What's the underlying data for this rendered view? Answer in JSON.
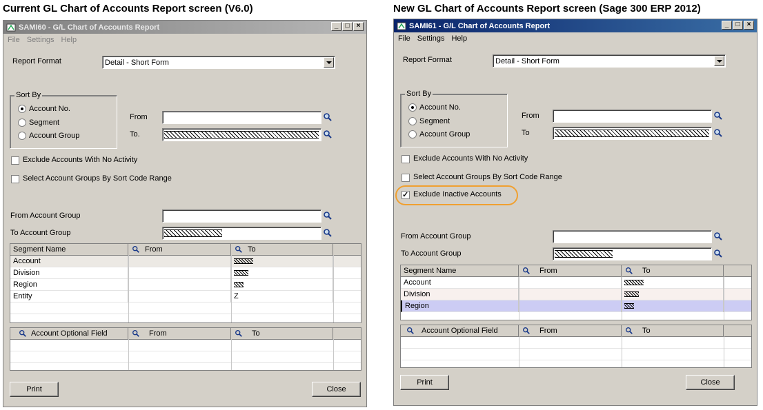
{
  "captions": {
    "left": "Current GL Chart of Accounts Report screen (V6.0)",
    "right": "New GL Chart of Accounts Report screen (Sage 300 ERP 2012)"
  },
  "left_window": {
    "title": "SAMI60 - G/L Chart of Accounts Report",
    "active": false,
    "menu": [
      "File",
      "Settings",
      "Help"
    ],
    "report_format_label": "Report Format",
    "report_format_value": "Detail - Short Form",
    "sort_by_label": "Sort By",
    "sort_options": [
      "Account No.",
      "Segment",
      "Account Group"
    ],
    "sort_selected": 0,
    "from_label": "From",
    "to_label": "To.",
    "checkboxes": [
      {
        "label": "Exclude Accounts With No Activity",
        "checked": false
      },
      {
        "label": "Select Account Groups By Sort Code Range",
        "checked": false
      }
    ],
    "from_account_group_label": "From Account Group",
    "to_account_group_label": "To Account Group",
    "segment_grid": {
      "headers": [
        "Segment Name",
        "From",
        "To"
      ],
      "rows": [
        {
          "name": "Account",
          "from": "",
          "to": "ZZZZ"
        },
        {
          "name": "Division",
          "from": "",
          "to": "ZZZ"
        },
        {
          "name": "Region",
          "from": "",
          "to": "ZZ"
        },
        {
          "name": "Entity",
          "from": "",
          "to": "Z"
        }
      ]
    },
    "optional_grid": {
      "headers": [
        "Account Optional Field",
        "From",
        "To"
      ]
    },
    "print_button": "Print",
    "close_button": "Close"
  },
  "right_window": {
    "title": "SAMI61 - G/L Chart of Accounts Report",
    "active": true,
    "menu": [
      "File",
      "Settings",
      "Help"
    ],
    "report_format_label": "Report Format",
    "report_format_value": "Detail - Short Form",
    "sort_by_label": "Sort By",
    "sort_options": [
      "Account No.",
      "Segment",
      "Account Group"
    ],
    "sort_selected": 0,
    "from_label": "From",
    "to_label": "To",
    "checkboxes": [
      {
        "label": "Exclude Accounts With No Activity",
        "checked": false
      },
      {
        "label": "Select Account Groups By Sort Code Range",
        "checked": false
      },
      {
        "label": "Exclude Inactive Accounts",
        "checked": true
      }
    ],
    "highlight_color": "#f0a030",
    "from_account_group_label": "From Account Group",
    "to_account_group_label": "To Account Group",
    "segment_grid": {
      "headers": [
        "Segment Name",
        "From",
        "To"
      ],
      "rows": [
        {
          "name": "Account",
          "from": "",
          "to": "ZZZZ"
        },
        {
          "name": "Division",
          "from": "",
          "to": "ZZZ"
        },
        {
          "name": "Region",
          "from": "",
          "to": "ZZ"
        }
      ],
      "selected_row": 2
    },
    "optional_grid": {
      "headers": [
        "Account Optional Field",
        "From",
        "To"
      ]
    },
    "print_button": "Print",
    "close_button": "Close"
  }
}
